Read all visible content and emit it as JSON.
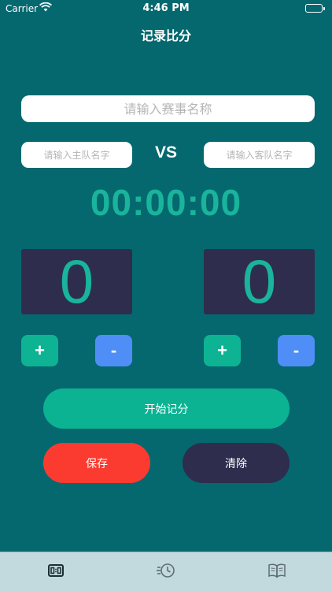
{
  "status_bar": {
    "carrier": "Carrier",
    "time": "4:46 PM"
  },
  "nav": {
    "title": "记录比分"
  },
  "inputs": {
    "match_placeholder": "请输入赛事名称",
    "home_placeholder": "请输入主队名字",
    "away_placeholder": "请输入客队名字"
  },
  "vs_label": "VS",
  "timer": "00:00:00",
  "scores": {
    "home": "0",
    "away": "0"
  },
  "buttons": {
    "plus": "+",
    "minus": "-",
    "start": "开始记分",
    "save": "保存",
    "clear": "清除"
  },
  "tabs": [
    {
      "icon": "scoreboard-icon",
      "active": true
    },
    {
      "icon": "history-icon",
      "active": false
    },
    {
      "icon": "book-icon",
      "active": false
    }
  ],
  "colors": {
    "background": "#05686f",
    "accent_green": "#0bb393",
    "timer_green": "#19b49b",
    "minus_blue": "#4f8ef7",
    "dark_navy": "#2e2d4d",
    "save_red": "#fb3b30",
    "tab_bar": "#c2d9de"
  }
}
